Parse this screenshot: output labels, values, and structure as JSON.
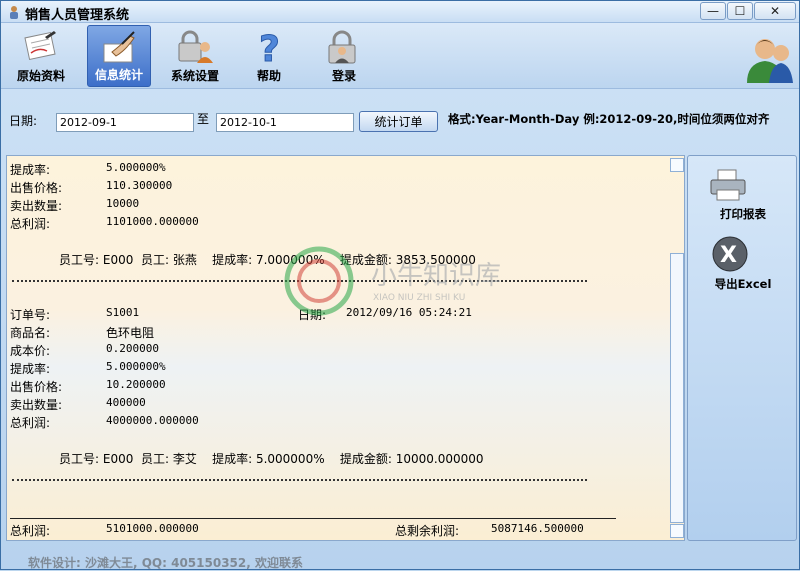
{
  "window": {
    "title": "销售人员管理系统",
    "minimize": "—",
    "maximize": "☐",
    "close": "✕"
  },
  "toolbar": {
    "items": [
      {
        "label": "原始资料",
        "icon": "document-pen-icon"
      },
      {
        "label": "信息统计",
        "icon": "writing-hand-icon",
        "active": true
      },
      {
        "label": "系统设置",
        "icon": "user-lock-icon"
      },
      {
        "label": "帮助",
        "icon": "question-mark-icon"
      },
      {
        "label": "登录",
        "icon": "lock-user-icon"
      }
    ]
  },
  "datebar": {
    "date_label": "日期:",
    "from": "2012-09-1",
    "to_label": "至",
    "to": "2012-10-1",
    "submit": "统计订单",
    "hint": "格式:Year-Month-Day 例:2012-09-20,时间位须两位对齐"
  },
  "report": {
    "top_rows": [
      {
        "k": "提成率:",
        "v": "5.000000%"
      },
      {
        "k": "出售价格:",
        "v": "110.300000"
      },
      {
        "k": "卖出数量:",
        "v": "10000"
      },
      {
        "k": "总利润:",
        "v": "1101000.000000"
      }
    ],
    "summary1": {
      "text": "员工号: E000  员工: 张燕    提成率: 7.000000%    提成金额: 3853.500000"
    },
    "order": {
      "id_label": "订单号:",
      "id": "S1001",
      "date_label": "日期:",
      "date": "2012/09/16 05:24:21"
    },
    "order_rows": [
      {
        "k": "商品名:",
        "v": "色环电阻"
      },
      {
        "k": "成本价:",
        "v": "0.200000"
      },
      {
        "k": "提成率:",
        "v": "5.000000%"
      },
      {
        "k": "出售价格:",
        "v": "10.200000"
      },
      {
        "k": "卖出数量:",
        "v": "400000"
      },
      {
        "k": "总利润:",
        "v": "4000000.000000"
      }
    ],
    "summary2": {
      "text": "员工号: E000  员工: 李艾    提成率: 5.000000%    提成金额: 10000.000000"
    },
    "total_label": "总利润:",
    "total": "5101000.000000",
    "remain_label": "总剩余利润:",
    "remain": "5087146.500000"
  },
  "side": {
    "print": "打印报表",
    "export": "导出Excel"
  },
  "watermark": {
    "cn": "小牛知识库",
    "en": "XIAO NIU ZHI SHI KU"
  },
  "footer": "软件设计: 沙滩大王, QQ: 405150352, 欢迎联系"
}
